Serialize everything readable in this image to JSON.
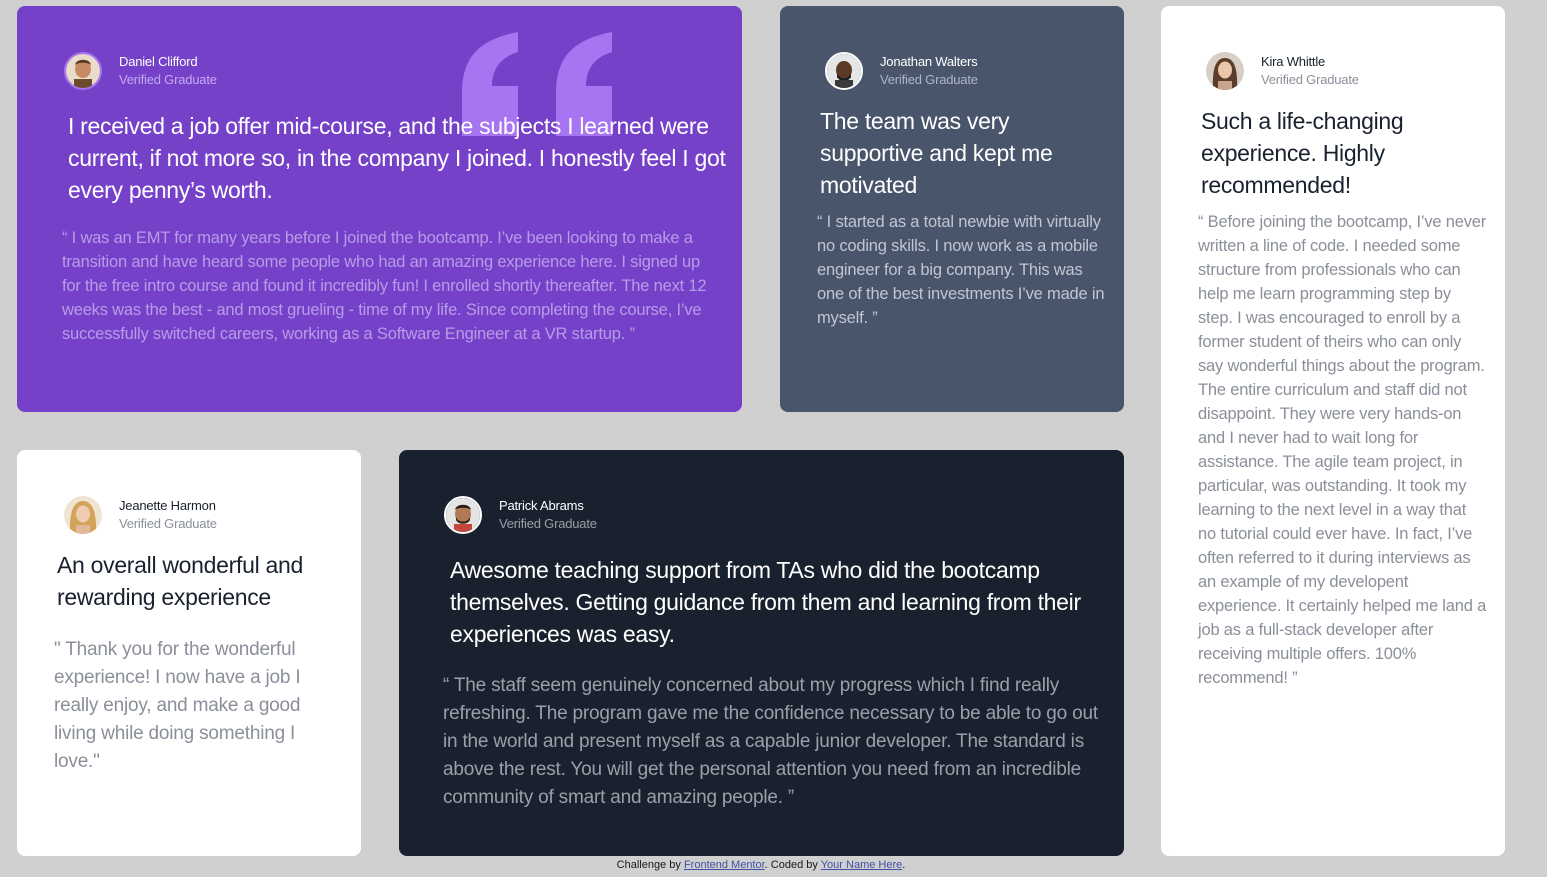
{
  "colors": {
    "background": "#d0d0d0",
    "purple_card": "#7541c8",
    "slate_card": "#48556a",
    "white_card": "#ffffff",
    "dark_card": "#19212e",
    "link": "#3e52a3"
  },
  "testimonials": [
    {
      "name": "Daniel Clifford",
      "role": "Verified Graduate",
      "headline": "I received a job offer mid-course, and the subjects I learned were current, if not more so, in the company I joined. I honestly feel I got every penny’s worth.",
      "quote": "“ I was an EMT for many years before I joined the bootcamp. I’ve been looking to make a transition and have heard some people who had an amazing experience here. I signed up for the free intro course and found it incredibly fun! I enrolled shortly thereafter. The next 12 weeks was the best - and most grueling - time of my life. Since completing the course, I’ve successfully switched careers, working as a Software Engineer at a VR startup. ”",
      "avatar_icon": "avatar-daniel"
    },
    {
      "name": "Jonathan Walters",
      "role": "Verified Graduate",
      "headline": "The team was very supportive and kept me motivated",
      "quote": "“ I started as a total newbie with virtually no coding skills. I now work as a mobile engineer for a big company. This was one of the best investments I’ve made in myself. ”",
      "avatar_icon": "avatar-jonathan"
    },
    {
      "name": "Kira Whittle",
      "role": "Verified Graduate",
      "headline": "Such a life-changing experience. Highly recommended!",
      "quote": "“ Before joining the bootcamp, I’ve never written a line of code. I needed some structure from professionals who can help me learn programming step by step. I was encouraged to enroll by a former student of theirs who can only say wonderful things about the program. The entire curriculum and staff did not disappoint. They were very hands-on and I never had to wait long for assistance. The agile team project, in particular, was outstanding. It took my learning to the next level in a way that no tutorial could ever have. In fact, I’ve often referred to it during interviews as an example of my developent experience. It certainly helped me land a job as a full-stack developer after receiving multiple offers. 100% recommend! ”",
      "avatar_icon": "avatar-kira"
    },
    {
      "name": "Jeanette Harmon",
      "role": "Verified Graduate",
      "headline": "An overall wonderful and rewarding experience",
      "quote": "\" Thank you for the wonderful experience! I now have a job I really enjoy, and make a good living while doing something I love.\"",
      "avatar_icon": "avatar-jeanette"
    },
    {
      "name": "Patrick Abrams",
      "role": "Verified Graduate",
      "headline": "Awesome teaching support from TAs who did the bootcamp themselves. Getting guidance from them and learning from their experiences was easy.",
      "quote": "“ The staff seem genuinely concerned about my progress which I find really refreshing. The program gave me the confidence necessary to be able to go out in the world and present myself as a capable junior developer. The standard is above the rest. You will get the personal attention you need from an incredible community of smart and amazing people. ”",
      "avatar_icon": "avatar-patrick"
    }
  ],
  "decor": {
    "quote_icon": "quotation-mark-icon"
  },
  "footer": {
    "prefix": "Challenge by ",
    "challenge_link": "Frontend Mentor",
    "middle": ". Coded by ",
    "author_link": "Your Name Here",
    "suffix": "."
  }
}
